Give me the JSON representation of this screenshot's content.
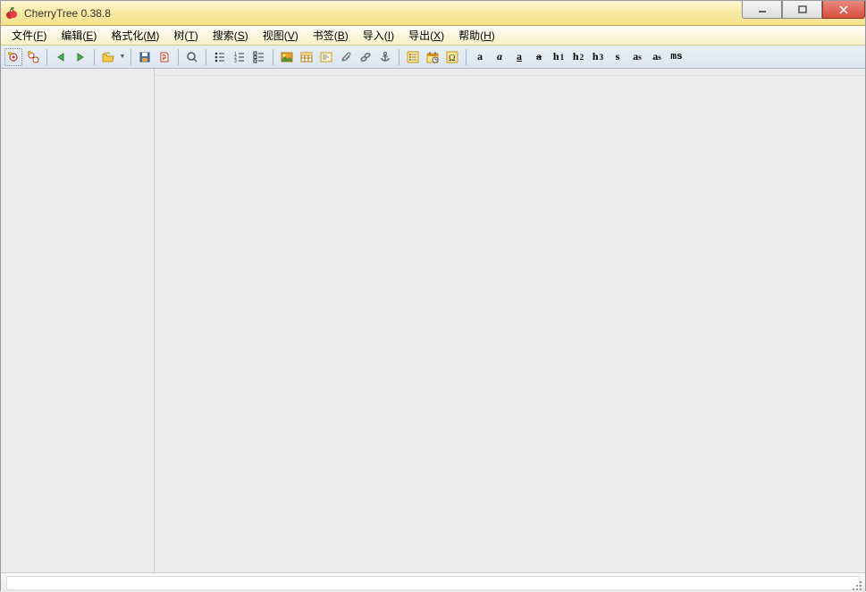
{
  "app": {
    "title": "CherryTree 0.38.8"
  },
  "menu": {
    "file": "文件(F)",
    "edit": "编辑(E)",
    "format": "格式化(M)",
    "tree": "树(T)",
    "search": "搜索(S)",
    "view": "视图(V)",
    "bookmark": "书签(B)",
    "import": "导入(I)",
    "export": "导出(X)",
    "help": "帮助(H)"
  },
  "toolbar": {
    "new_node": "新建节点",
    "new_subnode": "新建子节点",
    "back": "后退",
    "forward": "前进",
    "open": "打开",
    "save": "保存",
    "export_pdf": "导出PDF",
    "find": "查找",
    "list_bulleted": "项目列表",
    "list_numbered": "编号列表",
    "list_todo": "待办列表",
    "insert_image": "插入图片",
    "insert_table": "插入表格",
    "insert_codebox": "插入代码框",
    "insert_file": "插入文件",
    "insert_link": "插入链接",
    "insert_anchor": "插入锚点",
    "insert_toc": "目录",
    "timestamp": "时间戳",
    "special_char": "特殊字符",
    "bold": "a",
    "italic": "a",
    "underline": "a",
    "strikethrough": "a",
    "h1": "h",
    "h1_sub": "1",
    "h2": "h",
    "h2_sub": "2",
    "h3": "h",
    "h3_sub": "3",
    "small": "s",
    "superscript": "a",
    "superscript_sub": "s",
    "subscript": "a",
    "subscript_sub": "s",
    "monospace": "ms"
  }
}
